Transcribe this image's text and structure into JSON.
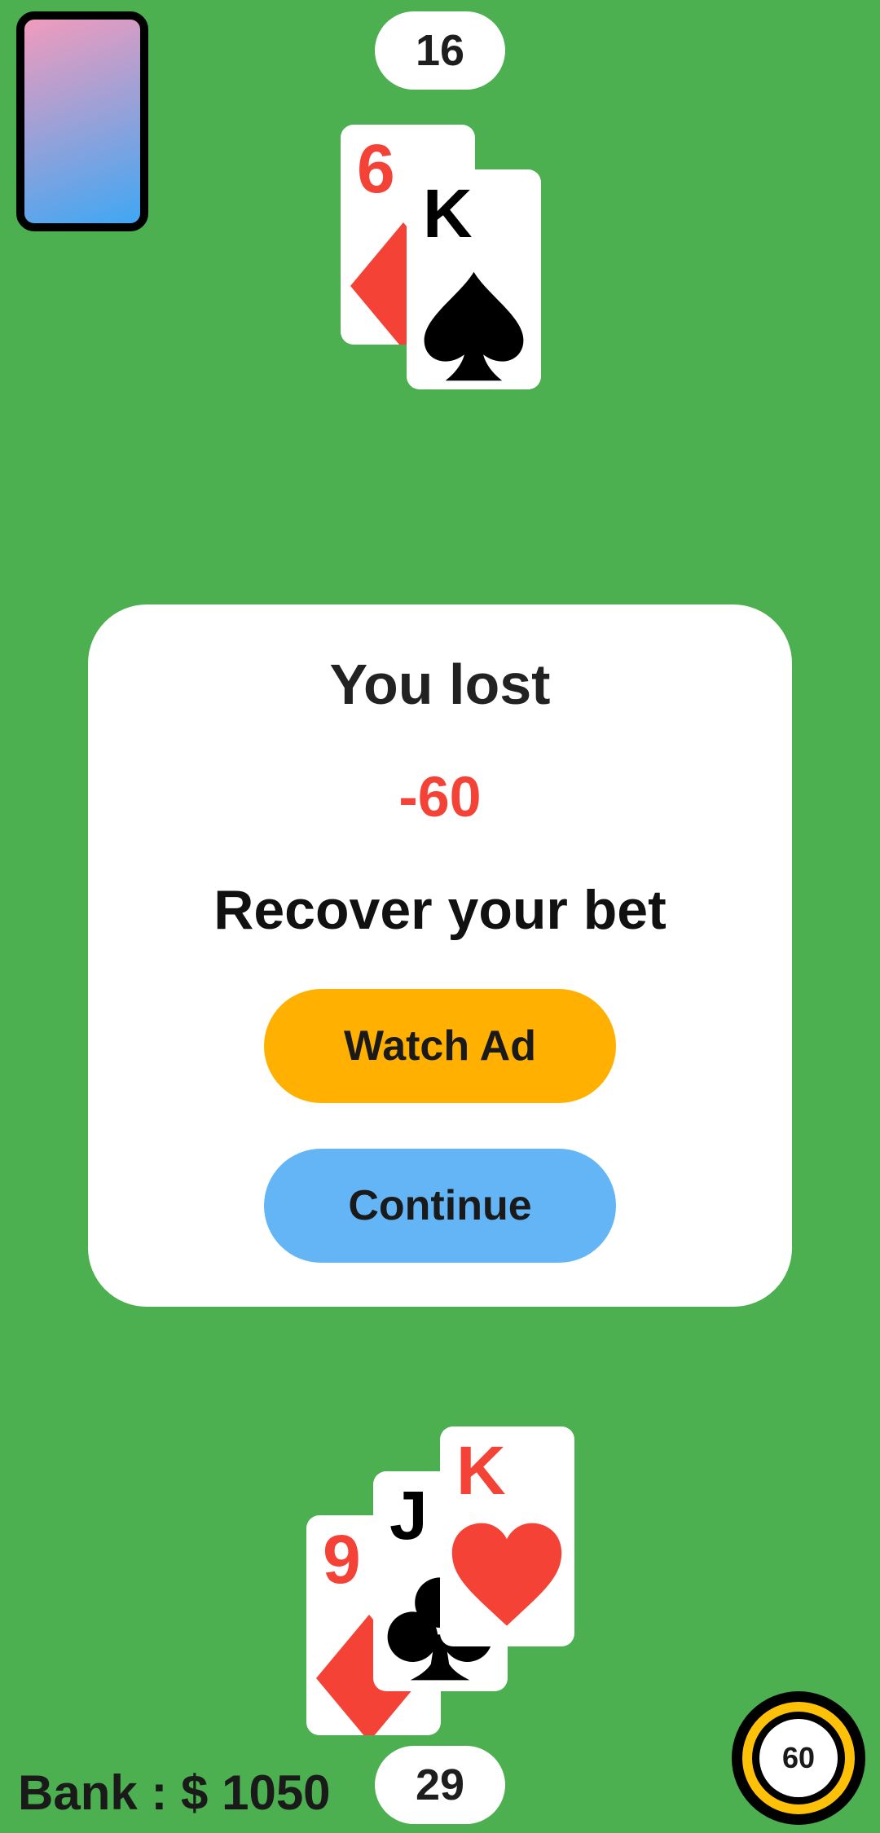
{
  "deck": {
    "icon": "card-back"
  },
  "dealer": {
    "score": "16",
    "cards": [
      {
        "rank": "6",
        "suit": "diamond",
        "color": "#f44336"
      },
      {
        "rank": "K",
        "suit": "spade",
        "color": "#000000"
      }
    ]
  },
  "dialog": {
    "title": "You lost",
    "amount": "-60",
    "subtitle": "Recover your bet",
    "watch_ad_label": "Watch Ad",
    "continue_label": "Continue"
  },
  "player": {
    "score": "29",
    "cards": [
      {
        "rank": "9",
        "suit": "diamond",
        "color": "#f44336"
      },
      {
        "rank": "J",
        "suit": "club",
        "color": "#000000"
      },
      {
        "rank": "K",
        "suit": "heart",
        "color": "#f44336"
      }
    ]
  },
  "bank": {
    "label": "Bank : $ 1050"
  },
  "bet": {
    "value": "60"
  },
  "colors": {
    "table": "#4caf50",
    "watch_ad": "#ffb000",
    "continue": "#64b5f6",
    "loss": "#f44336"
  }
}
